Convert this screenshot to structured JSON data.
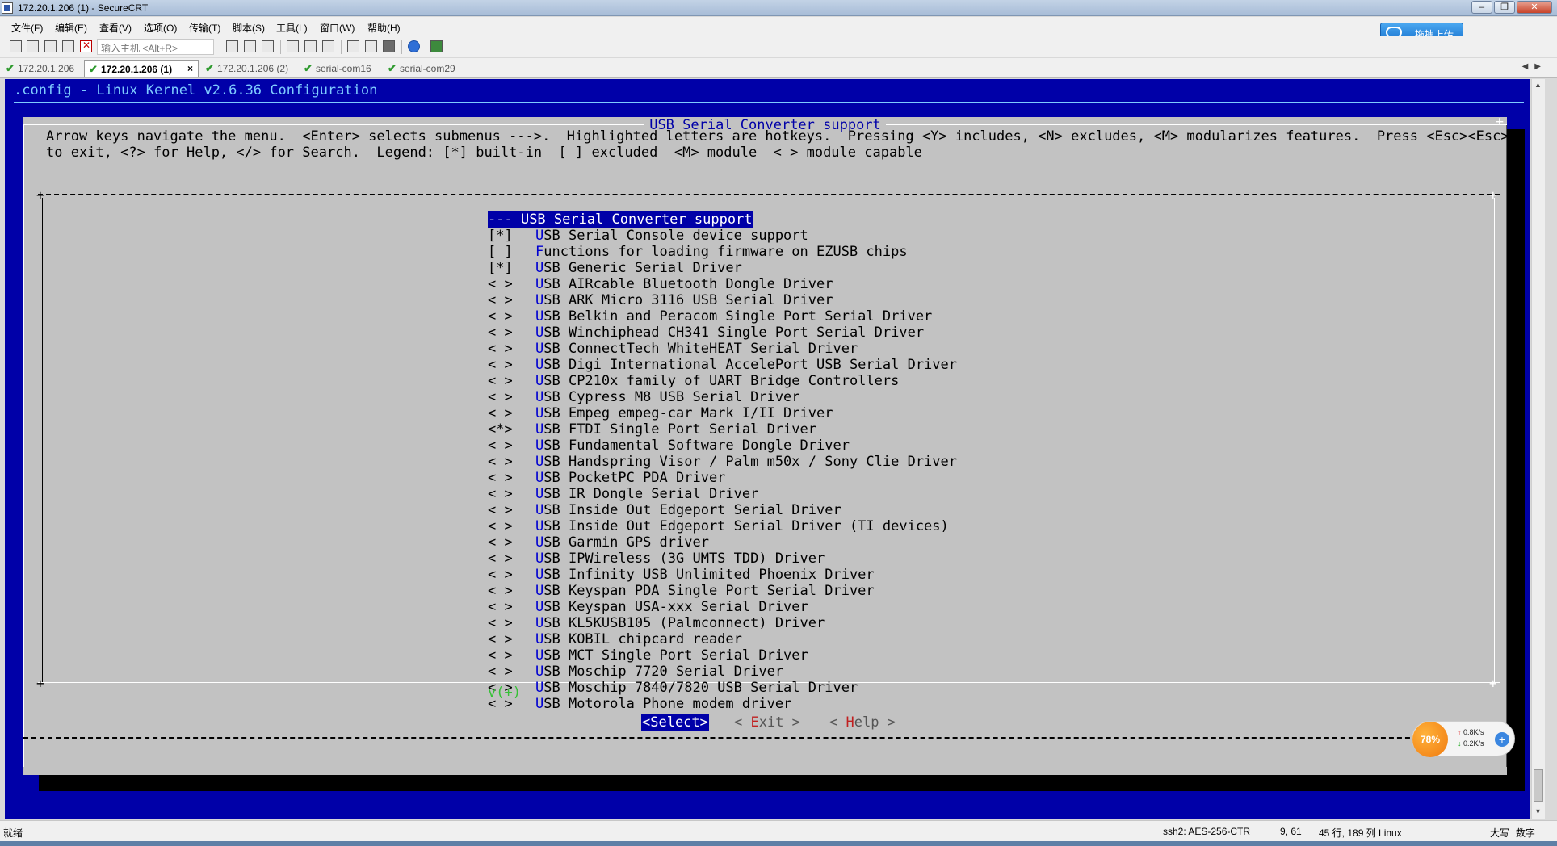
{
  "window": {
    "title": "172.20.1.206 (1) - SecureCRT"
  },
  "menubar": [
    "文件(F)",
    "编辑(E)",
    "查看(V)",
    "选项(O)",
    "传输(T)",
    "脚本(S)",
    "工具(L)",
    "窗口(W)",
    "帮助(H)"
  ],
  "upload_button": "拖拽上传",
  "toolbar": {
    "quick_connect_placeholder": "输入主机 <Alt+R>"
  },
  "tabs": [
    {
      "label": "172.20.1.206"
    },
    {
      "label": "172.20.1.206 (1)",
      "close": "×"
    },
    {
      "label": "172.20.1.206 (2)"
    },
    {
      "label": "serial-com16"
    },
    {
      "label": "serial-com29"
    }
  ],
  "terminal": {
    "header": ".config - Linux Kernel v2.6.36 Configuration",
    "dialog_title": "USB Serial Converter support",
    "help_line1": "Arrow keys navigate the menu.  <Enter> selects submenus --->.  Highlighted letters are hotkeys.  Pressing <Y> includes, <N> excludes, <M> modularizes features.  Press <Esc><Esc>",
    "help_line2": "to exit, <?> for Help, </> for Search.  Legend: [*] built-in  [ ] excluded  <M> module  < > module capable",
    "selected_item": {
      "mark": "--- ",
      "hotkey": "",
      "rest": "USB Serial Converter support"
    },
    "items": [
      {
        "mark": "[*]",
        "hotkey": "U",
        "rest": "SB Serial Console device support"
      },
      {
        "mark": "[ ]",
        "hotkey": "F",
        "rest": "unctions for loading firmware on EZUSB chips"
      },
      {
        "mark": "[*]",
        "hotkey": "U",
        "rest": "SB Generic Serial Driver"
      },
      {
        "mark": "< >",
        "hotkey": "U",
        "rest": "SB AIRcable Bluetooth Dongle Driver"
      },
      {
        "mark": "< >",
        "hotkey": "U",
        "rest": "SB ARK Micro 3116 USB Serial Driver"
      },
      {
        "mark": "< >",
        "hotkey": "U",
        "rest": "SB Belkin and Peracom Single Port Serial Driver"
      },
      {
        "mark": "< >",
        "hotkey": "U",
        "rest": "SB Winchiphead CH341 Single Port Serial Driver"
      },
      {
        "mark": "< >",
        "hotkey": "U",
        "rest": "SB ConnectTech WhiteHEAT Serial Driver"
      },
      {
        "mark": "< >",
        "hotkey": "U",
        "rest": "SB Digi International AccelePort USB Serial Driver"
      },
      {
        "mark": "< >",
        "hotkey": "U",
        "rest": "SB CP210x family of UART Bridge Controllers"
      },
      {
        "mark": "< >",
        "hotkey": "U",
        "rest": "SB Cypress M8 USB Serial Driver"
      },
      {
        "mark": "< >",
        "hotkey": "U",
        "rest": "SB Empeg empeg-car Mark I/II Driver"
      },
      {
        "mark": "<*>",
        "hotkey": "U",
        "rest": "SB FTDI Single Port Serial Driver"
      },
      {
        "mark": "< >",
        "hotkey": "U",
        "rest": "SB Fundamental Software Dongle Driver"
      },
      {
        "mark": "< >",
        "hotkey": "U",
        "rest": "SB Handspring Visor / Palm m50x / Sony Clie Driver"
      },
      {
        "mark": "< >",
        "hotkey": "U",
        "rest": "SB PocketPC PDA Driver"
      },
      {
        "mark": "< >",
        "hotkey": "U",
        "rest": "SB IR Dongle Serial Driver"
      },
      {
        "mark": "< >",
        "hotkey": "U",
        "rest": "SB Inside Out Edgeport Serial Driver"
      },
      {
        "mark": "< >",
        "hotkey": "U",
        "rest": "SB Inside Out Edgeport Serial Driver (TI devices)"
      },
      {
        "mark": "< >",
        "hotkey": "U",
        "rest": "SB Garmin GPS driver"
      },
      {
        "mark": "< >",
        "hotkey": "U",
        "rest": "SB IPWireless (3G UMTS TDD) Driver"
      },
      {
        "mark": "< >",
        "hotkey": "U",
        "rest": "SB Infinity USB Unlimited Phoenix Driver"
      },
      {
        "mark": "< >",
        "hotkey": "U",
        "rest": "SB Keyspan PDA Single Port Serial Driver"
      },
      {
        "mark": "< >",
        "hotkey": "U",
        "rest": "SB Keyspan USA-xxx Serial Driver"
      },
      {
        "mark": "< >",
        "hotkey": "U",
        "rest": "SB KL5KUSB105 (Palmconnect) Driver"
      },
      {
        "mark": "< >",
        "hotkey": "U",
        "rest": "SB KOBIL chipcard reader"
      },
      {
        "mark": "< >",
        "hotkey": "U",
        "rest": "SB MCT Single Port Serial Driver"
      },
      {
        "mark": "< >",
        "hotkey": "U",
        "rest": "SB Moschip 7720 Serial Driver"
      },
      {
        "mark": "< >",
        "hotkey": "U",
        "rest": "SB Moschip 7840/7820 USB Serial Driver"
      },
      {
        "mark": "< >",
        "hotkey": "U",
        "rest": "SB Motorola Phone modem driver"
      }
    ],
    "more_indicator": "v(+)",
    "buttons": {
      "select": "<Select>",
      "exit_pre": "< ",
      "exit_h": "E",
      "exit_rest": "xit >",
      "help_pre": "< ",
      "help_h": "H",
      "help_rest": "elp >"
    }
  },
  "netwidget": {
    "percent": "78%",
    "up": "0.8K/s",
    "down": "0.2K/s"
  },
  "statusbar": {
    "ready": "就绪",
    "cipher": "ssh2: AES-256-CTR",
    "cursor": "9, 61",
    "size": "45 行, 189 列 Linux",
    "caps": "大写",
    "num": "数字"
  }
}
